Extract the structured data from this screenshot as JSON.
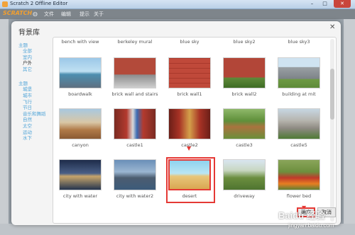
{
  "window": {
    "title": "Scratch 2 Offline Editor",
    "minimize_label": "–",
    "maximize_label": "□",
    "close_label": "✕"
  },
  "menubar": {
    "logo": "SCRATCH",
    "items": [
      "文件",
      "编辑",
      "提示",
      "关于"
    ]
  },
  "dialog": {
    "title": "背景库",
    "close_label": "✕",
    "ok_label": "确定",
    "cancel_label": "取消"
  },
  "sidebar": {
    "group1_header": "主题",
    "group1_items": [
      "全部",
      "室内",
      "户外",
      "其它"
    ],
    "group1_active": "户外",
    "group2_header": "主题",
    "group2_items": [
      "城堡",
      "城市",
      "飞行",
      "节日",
      "音乐和舞蹈",
      "自然",
      "太空",
      "运动",
      "水下"
    ]
  },
  "backdrops": {
    "row0": [
      "bench with view",
      "berkeley mural",
      "blue sky",
      "blue sky2",
      "blue sky3"
    ],
    "row1": [
      "boardwalk",
      "brick wall and stairs",
      "brick wall1",
      "brick wall2",
      "building at mit"
    ],
    "row2": [
      "canyon",
      "castle1",
      "castle2",
      "castle3",
      "castle5"
    ],
    "row3": [
      "city with water",
      "city with water2",
      "desert",
      "driveway",
      "flower bed"
    ],
    "selected": "desert"
  },
  "watermark": {
    "text": "Baidu 经验",
    "url": "jingyan.baidu.com"
  },
  "colors": {
    "accent": "#54a6d8",
    "highlight": "#e53935",
    "menubar": "#7e858b"
  }
}
